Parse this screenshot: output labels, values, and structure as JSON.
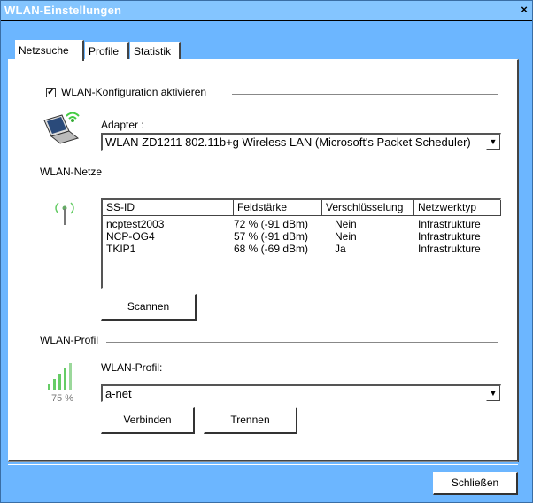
{
  "window": {
    "title": "WLAN-Einstellungen",
    "close_label": "×"
  },
  "tabs": [
    "Netzsuche",
    "Profile",
    "Statistik"
  ],
  "config": {
    "checkbox_label": "WLAN-Konfiguration aktivieren",
    "checked": true,
    "adapter_label": "Adapter :",
    "adapter_value": "WLAN ZD1211 802.11b+g Wireless LAN (Microsoft's Packet Scheduler)"
  },
  "networks": {
    "group_label": "WLAN-Netze",
    "columns": [
      "SS-ID",
      "Feldstärke",
      "Verschlüsselung",
      "Netzwerktyp"
    ],
    "rows": [
      [
        "ncptest2003",
        "72 % (-91 dBm)",
        "Nein",
        "Infrastrukture"
      ],
      [
        "NCP-OG4",
        "57 % (-91 dBm)",
        "Nein",
        "Infrastrukture"
      ],
      [
        "TKIP1",
        "68 % (-69 dBm)",
        "Ja",
        "Infrastrukture"
      ]
    ],
    "scan_button": "Scannen"
  },
  "profile": {
    "group_label": "WLAN-Profil",
    "field_label": "WLAN-Profil:",
    "value": "a-net",
    "signal_text": "75 %",
    "signal_level": 0.75,
    "connect_button": "Verbinden",
    "disconnect_button": "Trennen"
  },
  "footer": {
    "close_button": "Schließen"
  },
  "colors": {
    "title_bar": "#84c5ff",
    "background": "#ffffff",
    "frame": "#6cb6ff"
  }
}
